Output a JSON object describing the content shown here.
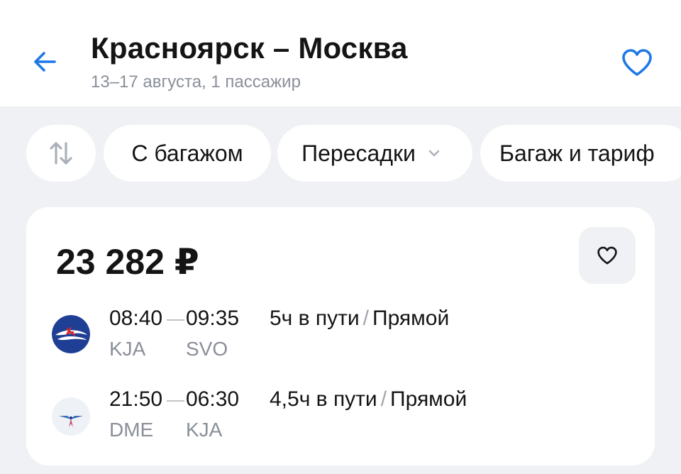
{
  "header": {
    "title": "Красноярск – Москва",
    "subtitle": "13–17 августа, 1 пассажир",
    "back_icon": "arrow-left-icon",
    "favorite_icon": "heart-outline-icon",
    "accent_color": "#1e78e6"
  },
  "filters": [
    {
      "id": "sort",
      "icon": "sort-arrows-icon"
    },
    {
      "id": "baggage",
      "label": "С багажом"
    },
    {
      "id": "transfers",
      "label": "Пересадки",
      "icon": "chevron-down-icon"
    },
    {
      "id": "tariff",
      "label": "Багаж и тариф"
    }
  ],
  "ticket": {
    "price": "23 282 ₽",
    "favorite_icon": "heart-outline-icon",
    "segments": [
      {
        "airline_icon": "aeroflot-logo-icon",
        "depart_time": "08:40",
        "arrive_time": "09:35",
        "depart_code": "KJA",
        "arrive_code": "SVO",
        "duration": "5ч в пути",
        "slash": "/",
        "type": "Прямой"
      },
      {
        "airline_icon": "bird-logo-icon",
        "depart_time": "21:50",
        "arrive_time": "06:30",
        "depart_code": "DME",
        "arrive_code": "KJA",
        "duration": "4,5ч в пути",
        "slash": "/",
        "type": "Прямой"
      }
    ]
  }
}
